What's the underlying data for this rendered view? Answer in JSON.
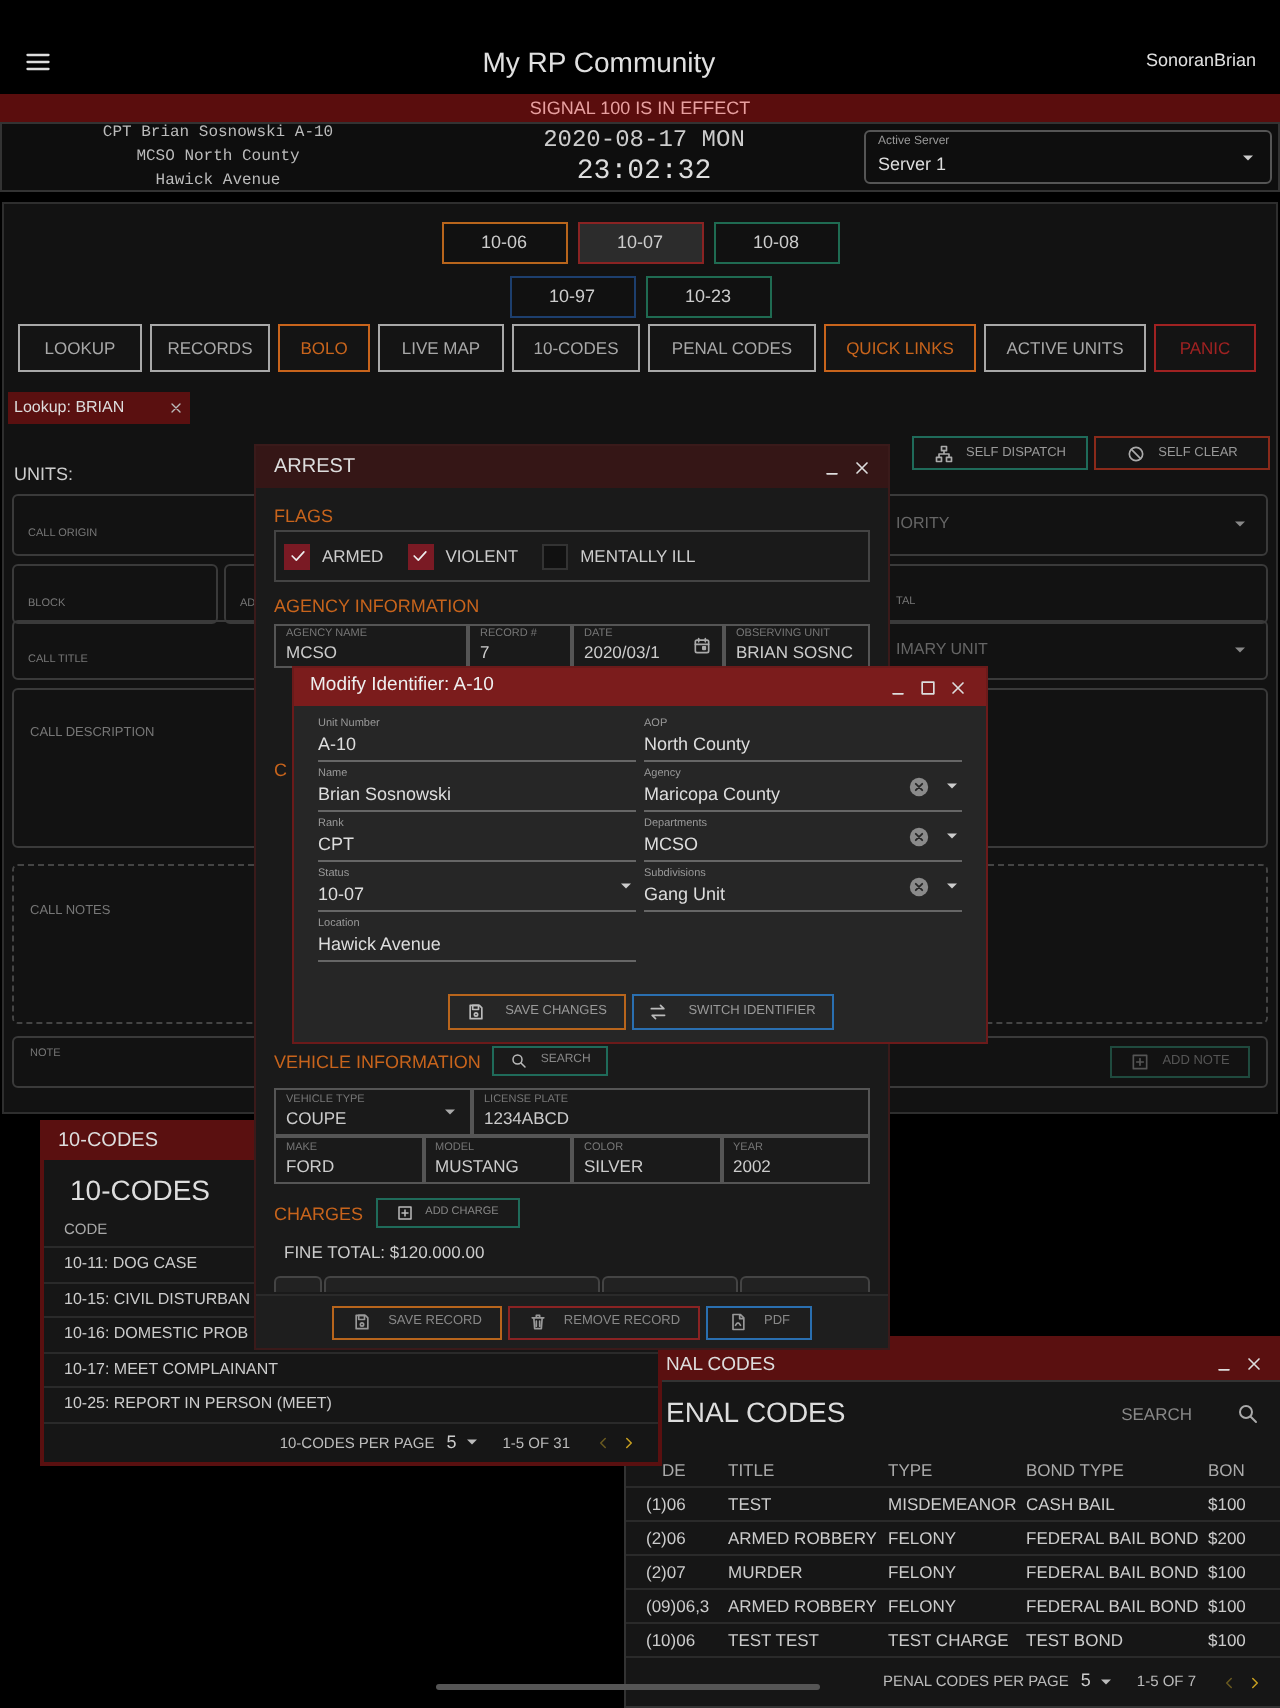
{
  "app_bar": {
    "title": "My RP Community",
    "user": "SonoranBrian"
  },
  "banner": {
    "text": "SIGNAL 100 IS IN EFFECT"
  },
  "unit_info": {
    "lines": [
      "CPT Brian Sosnowski A-10",
      "MCSO North County",
      "Hawick Avenue"
    ],
    "date": "2020-08-17 MON",
    "time": "23:02:32"
  },
  "server_select": {
    "label": "Active Server",
    "value": "Server 1"
  },
  "status_rows": [
    {
      "buttons": [
        {
          "label": "10-06",
          "color": "#b8651c",
          "selected": false
        },
        {
          "label": "10-07",
          "color": "#8a2323",
          "selected": true
        },
        {
          "label": "10-08",
          "color": "#1f6b52",
          "selected": false
        }
      ]
    },
    {
      "buttons": [
        {
          "label": "10-97",
          "color": "#1d3f6e",
          "selected": false
        },
        {
          "label": "10-23",
          "color": "#1f6b52",
          "selected": false
        }
      ]
    }
  ],
  "nav_buttons": [
    {
      "label": "LOOKUP",
      "color": "#a8a8a8"
    },
    {
      "label": "RECORDS",
      "color": "#a8a8a8"
    },
    {
      "label": "BOLO",
      "color": "#c8641c"
    },
    {
      "label": "LIVE MAP",
      "color": "#a8a8a8"
    },
    {
      "label": "10-CODES",
      "color": "#a8a8a8"
    },
    {
      "label": "PENAL CODES",
      "color": "#a8a8a8"
    },
    {
      "label": "QUICK LINKS",
      "color": "#c8641c"
    },
    {
      "label": "ACTIVE UNITS",
      "color": "#a8a8a8"
    },
    {
      "label": "PANIC",
      "color": "#a02222"
    }
  ],
  "tabs": [
    {
      "label": "Lookup: BRIAN",
      "selected": true
    }
  ],
  "dispatch": {
    "buttons": [
      {
        "label": "SELF DISPATCH",
        "kind": "dispatch"
      },
      {
        "label": "SELF CLEAR",
        "kind": "clear"
      }
    ],
    "units_label": "UNITS:",
    "form_rows": [
      {
        "left": [
          {
            "label": "CALL ORIGIN"
          }
        ],
        "right": {
          "label": "IORITY",
          "kind": "select"
        }
      },
      {
        "left": [
          {
            "label": "BLOCK"
          },
          {
            "label": "AD"
          }
        ],
        "right": {
          "label": "TAL",
          "kind": "text"
        }
      },
      {
        "left": [
          {
            "label": "CALL TITLE"
          }
        ],
        "right": {
          "label": "IMARY UNIT",
          "kind": "select"
        }
      }
    ],
    "description_label": "CALL DESCRIPTION",
    "notes_label": "CALL NOTES",
    "note_label": "NOTE",
    "add_note": "ADD NOTE"
  },
  "penal_window": {
    "title": "NAL CODES",
    "heading": "ENAL CODES",
    "search_placeholder": "SEARCH",
    "columns": [
      "DE",
      "TITLE",
      "TYPE",
      "BOND TYPE",
      "BON"
    ],
    "rows": [
      [
        "(1)06",
        "TEST",
        "MISDEMEANOR",
        "CASH BAIL",
        "$100"
      ],
      [
        "(2)06",
        "ARMED ROBBERY",
        "FELONY",
        "FEDERAL BAIL BOND",
        "$200"
      ],
      [
        "(2)07",
        "MURDER",
        "FELONY",
        "FEDERAL BAIL BOND",
        "$100"
      ],
      [
        "(09)06,3",
        "ARMED ROBBERY",
        "FELONY",
        "FEDERAL BAIL BOND",
        "$100"
      ],
      [
        "(10)06",
        "TEST TEST",
        "TEST CHARGE",
        "TEST BOND",
        "$100"
      ]
    ],
    "per_page_label": "PENAL CODES PER PAGE",
    "per_page": "5",
    "range": "1-5 OF 7"
  },
  "codes_window": {
    "title": "10-CODES",
    "heading": "10-CODES",
    "column": "CODE",
    "rows": [
      "10-11: DOG CASE",
      "10-15: CIVIL DISTURBAN",
      "10-16: DOMESTIC PROB",
      "10-17: MEET COMPLAINANT",
      "10-25: REPORT IN PERSON (MEET)"
    ],
    "per_page_label": "10-CODES PER PAGE",
    "per_page": "5",
    "range": "1-5 OF 31"
  },
  "arrest_window": {
    "title": "ARREST",
    "flags_label": "FLAGS",
    "flags": [
      {
        "label": "ARMED",
        "checked": true
      },
      {
        "label": "VIOLENT",
        "checked": true
      },
      {
        "label": "MENTALLY ILL",
        "checked": false
      }
    ],
    "agency_label": "AGENCY INFORMATION",
    "agency_fields": [
      {
        "label": "AGENCY NAME",
        "value": "MCSO",
        "kind": "text"
      },
      {
        "label": "RECORD #",
        "value": "7",
        "kind": "text"
      },
      {
        "label": "DATE",
        "value": "2020/03/1",
        "kind": "date"
      },
      {
        "label": "OBSERVING UNIT",
        "value": "BRIAN SOSNC",
        "kind": "text"
      }
    ],
    "partial_heading": "C",
    "vehicle_label": "VEHICLE INFORMATION",
    "search_button": "SEARCH",
    "vehicle_rows": [
      [
        {
          "label": "VEHICLE TYPE",
          "value": "COUPE",
          "kind": "select"
        },
        {
          "label": "LICENSE PLATE",
          "value": "1234ABCD",
          "kind": "text"
        }
      ],
      [
        {
          "label": "MAKE",
          "value": "FORD",
          "kind": "text"
        },
        {
          "label": "MODEL",
          "value": "MUSTANG",
          "kind": "text"
        },
        {
          "label": "COLOR",
          "value": "SILVER",
          "kind": "text"
        },
        {
          "label": "YEAR",
          "value": "2002",
          "kind": "text"
        }
      ]
    ],
    "charges_label": "CHARGES",
    "add_charge": "ADD CHARGE",
    "fine_total": "FINE TOTAL: $120.000.00",
    "footer_buttons": [
      {
        "label": "SAVE RECORD",
        "kind": "save"
      },
      {
        "label": "REMOVE RECORD",
        "kind": "remove"
      },
      {
        "label": "PDF",
        "kind": "pdf"
      }
    ]
  },
  "modify_window": {
    "title": "Modify Identifier: A-10",
    "fields": [
      {
        "label": "Unit Number",
        "value": "A-10",
        "kind": "text"
      },
      {
        "label": "AOP",
        "value": "North County",
        "kind": "text"
      },
      {
        "label": "Name",
        "value": "Brian Sosnowski",
        "kind": "text"
      },
      {
        "label": "Agency",
        "value": "Maricopa County",
        "kind": "clearable"
      },
      {
        "label": "Rank",
        "value": "CPT",
        "kind": "text"
      },
      {
        "label": "Departments",
        "value": "MCSO",
        "kind": "clearable"
      },
      {
        "label": "Status",
        "value": "10-07",
        "kind": "select"
      },
      {
        "label": "Subdivisions",
        "value": "Gang Unit",
        "kind": "clearable"
      },
      {
        "label": "Location",
        "value": "Hawick Avenue",
        "kind": "text"
      }
    ],
    "buttons": [
      {
        "label": "SAVE CHANGES",
        "kind": "save"
      },
      {
        "label": "SWITCH IDENTIFIER",
        "kind": "switch"
      }
    ]
  }
}
